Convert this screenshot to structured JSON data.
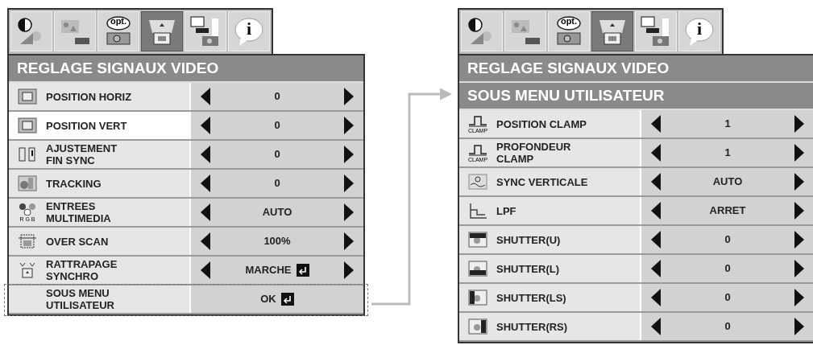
{
  "panels": [
    {
      "tabs": [
        {
          "kind": "contrast",
          "selected": false
        },
        {
          "kind": "picture",
          "selected": false
        },
        {
          "kind": "opt",
          "label": "opt.",
          "selected": false
        },
        {
          "kind": "signal",
          "selected": true
        },
        {
          "kind": "network",
          "selected": false
        },
        {
          "kind": "info",
          "label": "i",
          "selected": false
        }
      ],
      "title": "REGLAGE SIGNAUX VIDEO",
      "rows": [
        {
          "kind": "setting",
          "label": "POSITION HORIZ",
          "value": "0",
          "selected": false,
          "enter": false
        },
        {
          "kind": "setting",
          "label": "POSITION VERT",
          "value": "0",
          "selected": true,
          "enter": false
        },
        {
          "kind": "setting",
          "label": "AJUSTEMENT\nFIN SYNC",
          "value": "0",
          "selected": false,
          "enter": false
        },
        {
          "kind": "setting",
          "label": "TRACKING",
          "value": "0",
          "selected": false,
          "enter": false
        },
        {
          "kind": "setting",
          "icon_caption": "R G B",
          "label": "ENTREES\nMULTIMEDIA",
          "value": "AUTO",
          "selected": false,
          "enter": false
        },
        {
          "kind": "setting",
          "label": "OVER SCAN",
          "value": "100%",
          "selected": false,
          "enter": false
        },
        {
          "kind": "setting",
          "label": "RATTRAPAGE\nSYNCHRO",
          "value": "MARCHE",
          "selected": false,
          "enter": true
        },
        {
          "kind": "submenu",
          "label": "SOUS MENU\nUTILISATEUR",
          "value": "OK",
          "selected": false,
          "enter": true
        }
      ]
    },
    {
      "tabs": [
        {
          "kind": "contrast",
          "selected": false
        },
        {
          "kind": "picture",
          "selected": false
        },
        {
          "kind": "opt",
          "label": "opt.",
          "selected": false
        },
        {
          "kind": "signal",
          "selected": true
        },
        {
          "kind": "network",
          "selected": false
        },
        {
          "kind": "info",
          "label": "i",
          "selected": false
        }
      ],
      "title": "REGLAGE SIGNAUX VIDEO",
      "subtitle": "SOUS MENU UTILISATEUR",
      "rows": [
        {
          "kind": "setting",
          "icon_caption": "CLAMP",
          "label": "POSITION CLAMP",
          "value": "1",
          "selected": false,
          "enter": false
        },
        {
          "kind": "setting",
          "icon_caption": "CLAMP",
          "label": "PROFONDEUR\nCLAMP",
          "value": "1",
          "selected": false,
          "enter": false
        },
        {
          "kind": "setting",
          "label": "SYNC VERTICALE",
          "value": "AUTO",
          "selected": false,
          "enter": false
        },
        {
          "kind": "setting",
          "label": "LPF",
          "value": "ARRET",
          "selected": false,
          "enter": false
        },
        {
          "kind": "setting",
          "label": "SHUTTER(U)",
          "value": "0",
          "selected": false,
          "enter": false
        },
        {
          "kind": "setting",
          "label": "SHUTTER(L)",
          "value": "0",
          "selected": false,
          "enter": false
        },
        {
          "kind": "setting",
          "label": "SHUTTER(LS)",
          "value": "0",
          "selected": false,
          "enter": false
        },
        {
          "kind": "setting",
          "label": "SHUTTER(RS)",
          "value": "0",
          "selected": false,
          "enter": false
        }
      ]
    }
  ]
}
